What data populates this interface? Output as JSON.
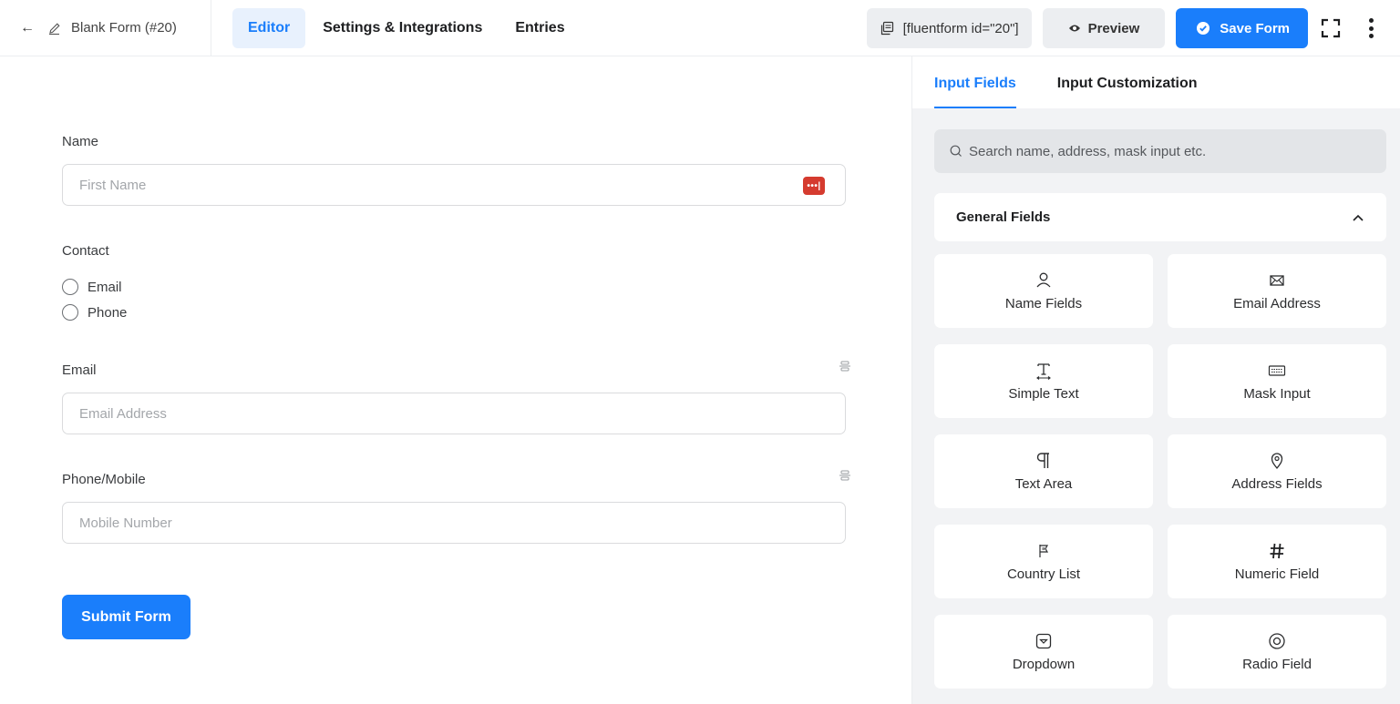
{
  "header": {
    "back_icon": "arrow-left-icon",
    "form_title": "Blank Form (#20)",
    "tabs": [
      {
        "label": "Editor",
        "active": true
      },
      {
        "label": "Settings & Integrations",
        "active": false
      },
      {
        "label": "Entries",
        "active": false
      }
    ],
    "shortcode": "[fluentform id=\"20\"]",
    "preview_label": "Preview",
    "save_label": "Save Form"
  },
  "form": {
    "name": {
      "label": "Name",
      "placeholder": "First Name"
    },
    "contact": {
      "label": "Contact",
      "options": [
        "Email",
        "Phone"
      ]
    },
    "email": {
      "label": "Email",
      "placeholder": "Email Address"
    },
    "phone": {
      "label": "Phone/Mobile",
      "placeholder": "Mobile Number"
    },
    "submit_label": "Submit Form"
  },
  "sidebar": {
    "tabs": [
      {
        "label": "Input Fields",
        "active": true
      },
      {
        "label": "Input Customization",
        "active": false
      }
    ],
    "search_placeholder": "Search name, address, mask input etc.",
    "section_title": "General Fields",
    "fields": [
      {
        "label": "Name Fields",
        "icon": "user-icon"
      },
      {
        "label": "Email Address",
        "icon": "envelope-icon"
      },
      {
        "label": "Simple Text",
        "icon": "text-cursor-icon"
      },
      {
        "label": "Mask Input",
        "icon": "keyboard-icon"
      },
      {
        "label": "Text Area",
        "icon": "paragraph-icon"
      },
      {
        "label": "Address Fields",
        "icon": "map-pin-icon"
      },
      {
        "label": "Country List",
        "icon": "flag-icon"
      },
      {
        "label": "Numeric Field",
        "icon": "hash-icon"
      },
      {
        "label": "Dropdown",
        "icon": "dropdown-icon"
      },
      {
        "label": "Radio Field",
        "icon": "radio-icon"
      }
    ]
  },
  "colors": {
    "accent": "#1a7efb",
    "password_badge": "#d53b2f"
  }
}
